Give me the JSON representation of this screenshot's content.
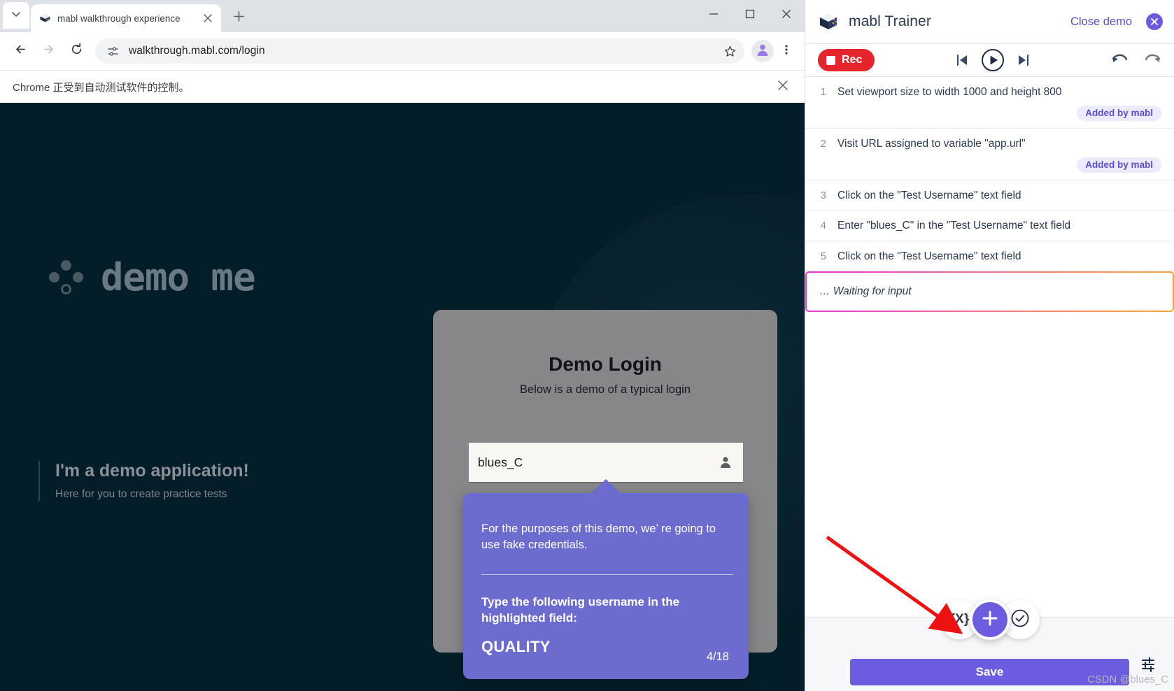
{
  "browser": {
    "tab": {
      "title": "mabl walkthrough experience",
      "favicon_icon": "mabl-favicon"
    },
    "new_tab_icon": "plus-icon",
    "tab_list_icon": "chevron-down-icon",
    "tab_close_icon": "close-icon",
    "nav": {
      "back_icon": "arrow-left-icon",
      "forward_icon": "arrow-right-icon",
      "reload_icon": "reload-icon"
    },
    "omnibox": {
      "site_info_icon": "page-settings-icon",
      "url": "walkthrough.mabl.com/login",
      "bookmark_icon": "star-icon"
    },
    "profile_icon": "profile-avatar-icon",
    "menu_icon": "kebab-menu-icon",
    "window": {
      "minimize_icon": "minimize-icon",
      "maximize_icon": "maximize-icon",
      "close_icon": "window-close-icon"
    },
    "infobar": {
      "message": "Chrome 正受到自动测试软件的控制。",
      "close_icon": "close-icon"
    }
  },
  "page": {
    "logo_text": "demo me",
    "logo_mark_icon": "demo-me-dots-icon",
    "tagline": {
      "heading": "I'm a demo application!",
      "subheading": "Here for you to create practice tests"
    },
    "login_card": {
      "title": "Demo Login",
      "subtitle": "Below is a demo of a typical login",
      "username_value": "blues_C",
      "username_icon": "person-icon"
    },
    "tooltip": {
      "paragraph1": "For the purposes of this demo, we’  re going to use fake credentials.",
      "paragraph2": "Type the following username in the highlighted field:",
      "answer": "QUALITY",
      "counter": "4/18",
      "color": "#6c6ccf"
    }
  },
  "trainer": {
    "logo_icon": "mabl-cube-icon",
    "title": "mabl Trainer",
    "close_demo_label": "Close demo",
    "close_demo_icon": "close-circle-icon",
    "toolbar": {
      "record_label": "Rec",
      "record_icon": "stop-square-icon",
      "step_back_icon": "skip-previous-icon",
      "play_icon": "play-circle-icon",
      "step_forward_icon": "skip-next-icon",
      "undo_icon": "undo-icon",
      "redo_icon": "redo-icon"
    },
    "steps": [
      {
        "num": "1",
        "text": "Set viewport size to width 1000 and height 800",
        "badge": "Added by mabl"
      },
      {
        "num": "2",
        "text": "Visit URL assigned to variable \"app.url\"",
        "badge": "Added by mabl"
      },
      {
        "num": "3",
        "text": "Click on the \"Test Username\" text field",
        "badge": ""
      },
      {
        "num": "4",
        "text": "Enter \"blues_C\" in the \"Test Username\" text field",
        "badge": ""
      },
      {
        "num": "5",
        "text": "Click on the \"Test Username\" text field",
        "badge": ""
      }
    ],
    "waiting_text": "… Waiting for input",
    "footer": {
      "variable_button_label": "{X}",
      "add_step_icon": "plus-icon",
      "assertion_icon": "check-circle-icon",
      "settings_icon": "sliders-icon",
      "save_label": "Save"
    },
    "watermark": "CSDN @blues_C",
    "accent_color": "#6c5ce0",
    "record_color": "#e4262c"
  }
}
